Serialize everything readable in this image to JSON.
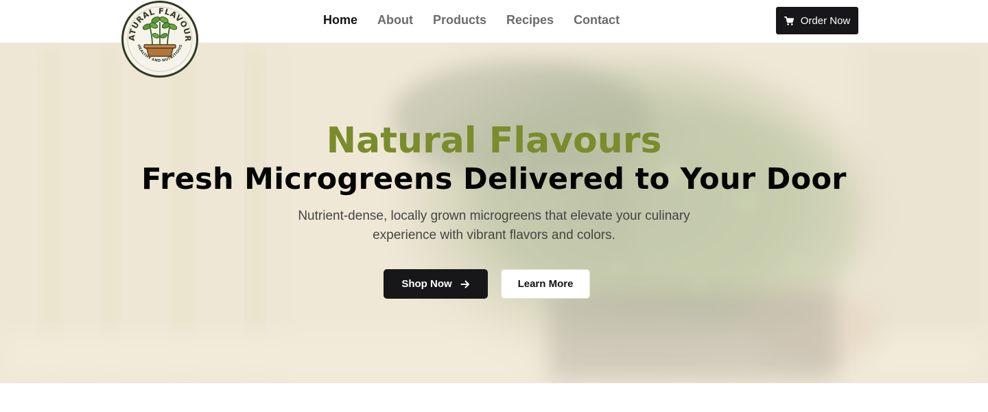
{
  "logo": {
    "name": "NATURAL FLAVOURS",
    "tagline": "HEALTHY AND NUTRITIOUS",
    "icon": "seedling-pot-icon"
  },
  "nav": {
    "items": [
      {
        "label": "Home",
        "active": true
      },
      {
        "label": "About",
        "active": false
      },
      {
        "label": "Products",
        "active": false
      },
      {
        "label": "Recipes",
        "active": false
      },
      {
        "label": "Contact",
        "active": false
      }
    ],
    "order_button": {
      "label": "Order Now",
      "icon": "cart-icon"
    }
  },
  "hero": {
    "brand": "Natural Flavours",
    "headline": "Fresh Microgreens Delivered to Your Door",
    "subtitle": "Nutrient-dense, locally grown microgreens that elevate your culinary experience with vibrant flavors and colors.",
    "primary_button": {
      "label": "Shop Now",
      "icon": "arrow-right-icon"
    },
    "secondary_button": {
      "label": "Learn More"
    }
  },
  "colors": {
    "brand_green": "#7a8c2b",
    "dark": "#17171a",
    "hero_bg": "#eee7d7",
    "logo_ring": "#2f3a22"
  }
}
